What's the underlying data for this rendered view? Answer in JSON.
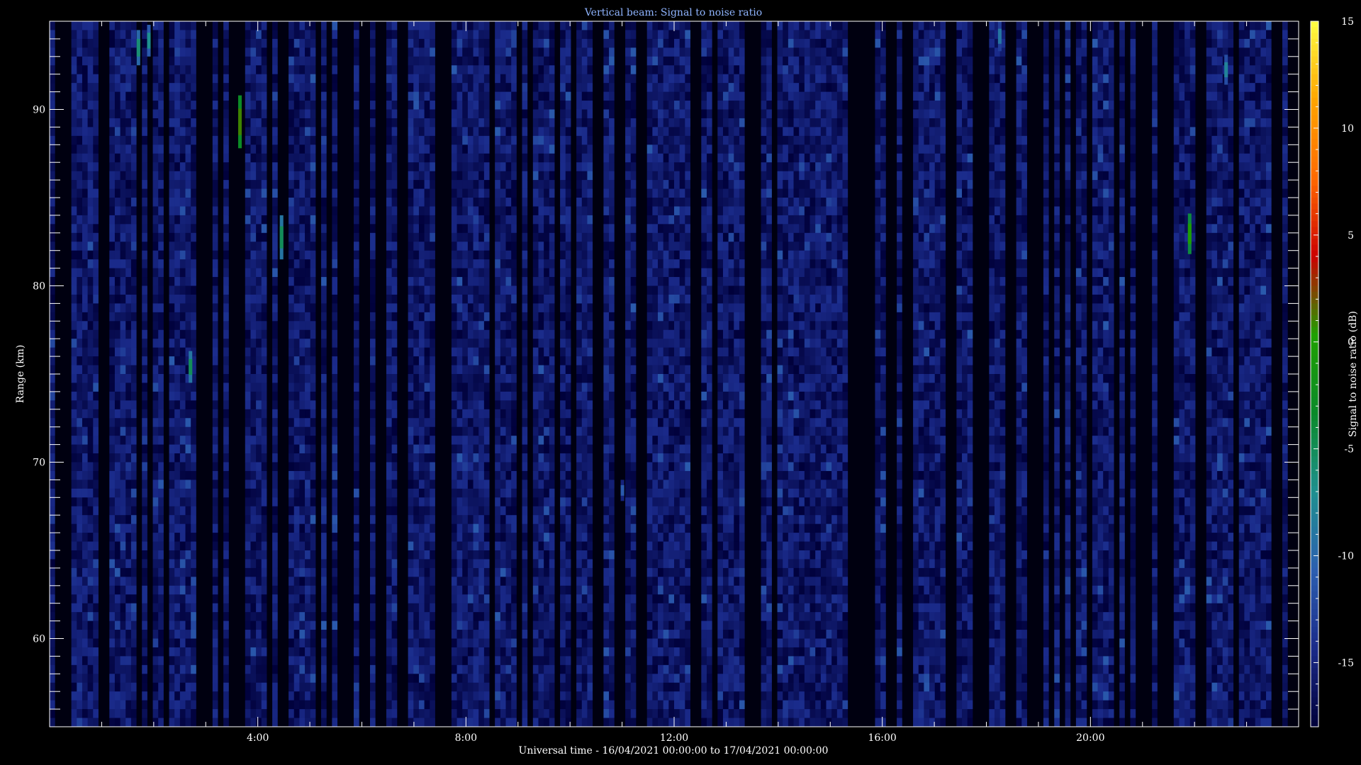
{
  "chart_data": {
    "type": "heatmap",
    "title": "Vertical beam: Signal to noise ratio",
    "xlabel": "Universal time - 16/04/2021 00:00:00 to 17/04/2021 00:00:00",
    "ylabel": "Range (km)",
    "colorbar_label": "Signal to noise ratio (dB)",
    "xlim_hours": [
      0,
      24
    ],
    "ylim_km": [
      55,
      95
    ],
    "x_ticks": [
      {
        "value": 4,
        "label": "4:00"
      },
      {
        "value": 8,
        "label": "8:00"
      },
      {
        "value": 12,
        "label": "12:00"
      },
      {
        "value": 16,
        "label": "16:00"
      },
      {
        "value": 20,
        "label": "20:00"
      }
    ],
    "y_ticks": [
      {
        "value": 60,
        "label": "60"
      },
      {
        "value": 70,
        "label": "70"
      },
      {
        "value": 80,
        "label": "80"
      },
      {
        "value": 90,
        "label": "90"
      }
    ],
    "colorbar_range": [
      -18,
      15
    ],
    "colorbar_ticks": [
      {
        "value": 15,
        "label": "15"
      },
      {
        "value": 10,
        "label": "10"
      },
      {
        "value": 5,
        "label": "5"
      },
      {
        "value": 0,
        "label": "0"
      },
      {
        "value": -5,
        "label": "-5"
      },
      {
        "value": -10,
        "label": "-10"
      },
      {
        "value": -15,
        "label": "-15"
      }
    ],
    "background_snr_db": -16,
    "highlights": [
      {
        "time_h": 1.7,
        "range_km": [
          92.5,
          94.5
        ],
        "snr_db": -6
      },
      {
        "time_h": 1.9,
        "range_km": [
          93.0,
          94.8
        ],
        "snr_db": -7
      },
      {
        "time_h": 2.7,
        "range_km": [
          74.5,
          76.3
        ],
        "snr_db": -5
      },
      {
        "time_h": 3.65,
        "range_km": [
          87.8,
          90.8
        ],
        "snr_db": 1
      },
      {
        "time_h": 4.45,
        "range_km": [
          81.5,
          84.0
        ],
        "snr_db": -5
      },
      {
        "time_h": 11.0,
        "range_km": [
          67.8,
          69.0
        ],
        "snr_db": -11
      },
      {
        "time_h": 18.25,
        "range_km": [
          93.3,
          95.0
        ],
        "snr_db": -9
      },
      {
        "time_h": 21.9,
        "range_km": [
          81.8,
          84.1
        ],
        "snr_db": 0
      },
      {
        "time_h": 22.6,
        "range_km": [
          91.4,
          93.1
        ],
        "snr_db": -8
      }
    ],
    "colormap": [
      "#00003a",
      "#1a2a8a",
      "#2c5fb0",
      "#1e9090",
      "#0a8a2a",
      "#1fa000",
      "#cc0000",
      "#ff6a00",
      "#ffa500",
      "#ffff44"
    ]
  }
}
